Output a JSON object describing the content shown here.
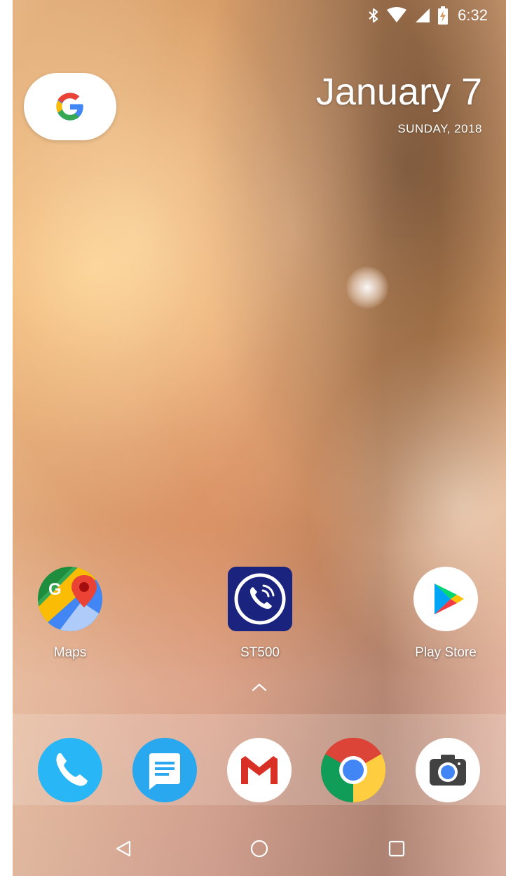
{
  "status_bar": {
    "time": "6:32",
    "icons": [
      "bluetooth-icon",
      "wifi-icon",
      "cell-signal-icon",
      "battery-charging-icon"
    ]
  },
  "search_widget": {
    "icon": "google-g-icon"
  },
  "date_widget": {
    "date": "January 7",
    "day_year": "SUNDAY, 2018"
  },
  "home_apps": [
    {
      "label": "Maps",
      "icon": "maps-icon"
    },
    {
      "label": "ST500",
      "icon": "st500-phone-icon",
      "color": "#1a237e"
    },
    {
      "label": "Play Store",
      "icon": "play-store-icon"
    }
  ],
  "app_drawer": {
    "icon": "chevron-up-icon"
  },
  "dock": [
    {
      "icon": "phone-icon",
      "color": "#29b6f6"
    },
    {
      "icon": "messages-icon",
      "color": "#29a8f0"
    },
    {
      "icon": "gmail-icon",
      "color": "#ffffff"
    },
    {
      "icon": "chrome-icon"
    },
    {
      "icon": "camera-icon",
      "color": "#ffffff"
    }
  ],
  "nav_bar": [
    "back-icon",
    "home-icon",
    "recents-icon"
  ]
}
